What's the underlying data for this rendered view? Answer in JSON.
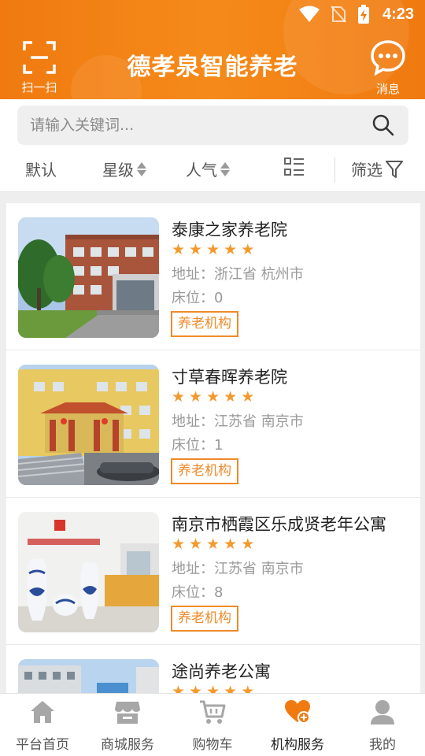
{
  "status_bar": {
    "time": "4:23"
  },
  "header": {
    "title": "德孝泉智能养老",
    "scan_label": "扫一扫",
    "message_label": "消息"
  },
  "search": {
    "placeholder": "请输入关键词..."
  },
  "filters": {
    "default": "默认",
    "star": "星级",
    "popularity": "人气",
    "filter": "筛选"
  },
  "institutions": [
    {
      "name": "泰康之家养老院",
      "rating": 5,
      "address": "地址：浙江省 杭州市",
      "beds": "床位：0",
      "tag": "养老机构"
    },
    {
      "name": "寸草春晖养老院",
      "rating": 5,
      "address": "地址：江苏省 南京市",
      "beds": "床位：1",
      "tag": "养老机构"
    },
    {
      "name": "南京市栖霞区乐成贤老年公寓",
      "rating": 5,
      "address": "地址：江苏省 南京市",
      "beds": "床位：8",
      "tag": "养老机构"
    },
    {
      "name": "途尚养老公寓",
      "rating": 5,
      "address": "",
      "beds": "",
      "tag": ""
    }
  ],
  "bottom_nav": [
    {
      "label": "平台首页",
      "icon": "home-icon"
    },
    {
      "label": "商城服务",
      "icon": "store-icon"
    },
    {
      "label": "购物车",
      "icon": "cart-icon"
    },
    {
      "label": "机构服务",
      "icon": "heart-plus-icon",
      "active": true
    },
    {
      "label": "我的",
      "icon": "user-icon"
    }
  ],
  "colors": {
    "accent": "#f58a1a",
    "star": "#f39a2e",
    "active_nav": "#f07a10"
  }
}
